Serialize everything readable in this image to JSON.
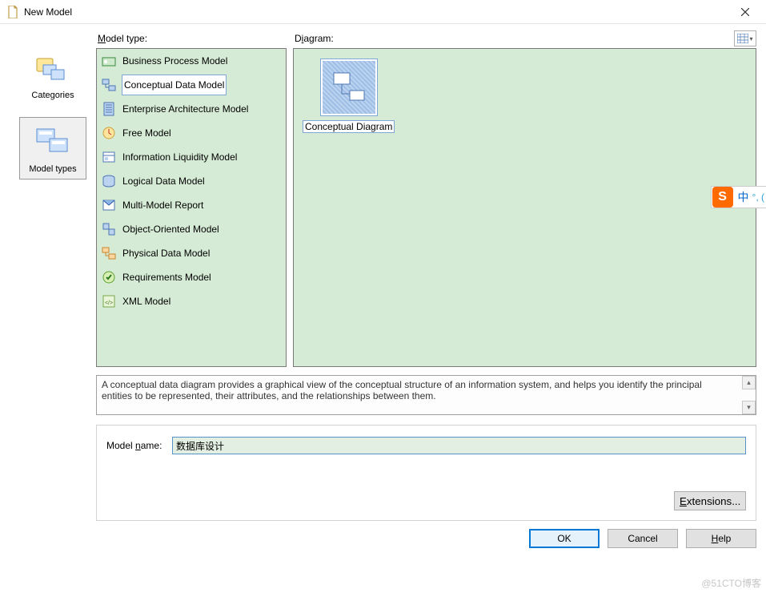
{
  "title": "New Model",
  "labels": {
    "model_type": "Model type:",
    "diagram": "Diagram:",
    "model_name": "Model name:"
  },
  "sidebar": {
    "categories": "Categories",
    "model_types": "Model types"
  },
  "model_types": [
    "Business Process Model",
    "Conceptual Data Model",
    "Enterprise Architecture Model",
    "Free Model",
    "Information Liquidity Model",
    "Logical Data Model",
    "Multi-Model Report",
    "Object-Oriented Model",
    "Physical Data Model",
    "Requirements Model",
    "XML Model"
  ],
  "selected_model_type_index": 1,
  "diagrams": [
    "Conceptual Diagram"
  ],
  "description": "A conceptual data diagram provides a graphical view of the conceptual structure of an information system, and helps you identify the principal entities to be represented, their attributes, and the relationships between them.",
  "model_name": "数据库设计",
  "buttons": {
    "extensions": "Extensions...",
    "ok": "OK",
    "cancel": "Cancel",
    "help": "Help"
  },
  "floater": {
    "s": "S",
    "cn": "中"
  },
  "watermark": "@51CTO博客",
  "icons": {
    "mt": [
      "bpm",
      "cdm",
      "eam",
      "free",
      "ilm",
      "ldm",
      "mmr",
      "oom",
      "pdm",
      "req",
      "xml"
    ]
  }
}
